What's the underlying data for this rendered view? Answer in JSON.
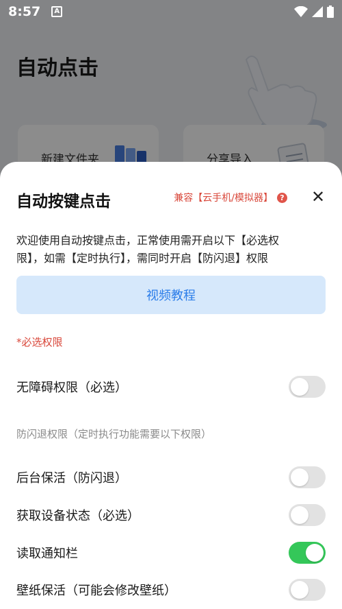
{
  "status_bar": {
    "time": "8:57",
    "a_label": "A"
  },
  "background": {
    "title": "自动点击",
    "cards": [
      {
        "label": "新建文件夹"
      },
      {
        "label": "分享导入"
      }
    ]
  },
  "sheet": {
    "title": "自动按键点击",
    "compat_label": "兼容【云手机/模拟器】",
    "help_glyph": "?",
    "close_glyph": "✕",
    "description": "欢迎使用自动按键点击，正常使用需开启以下【必选权限】，如需【定时执行】，需同时开启【防闪退】权限",
    "video_button": "视频教程",
    "required_label": "*必选权限",
    "required_permissions": [
      {
        "label": "无障碍权限（必选）",
        "enabled": false
      }
    ],
    "optional_section_label": "防闪退权限（定时执行功能需要以下权限）",
    "optional_permissions": [
      {
        "label": "后台保活（防闪退）",
        "enabled": false
      },
      {
        "label": "获取设备状态（必选）",
        "enabled": false
      },
      {
        "label": "读取通知栏",
        "enabled": true
      },
      {
        "label": "壁纸保活（可能会修改壁纸）",
        "enabled": false
      }
    ]
  },
  "colors": {
    "accent_red": "#d9483b",
    "accent_blue": "#2b7de9",
    "toggle_on": "#34c759",
    "toggle_off": "#e2e2e2"
  }
}
